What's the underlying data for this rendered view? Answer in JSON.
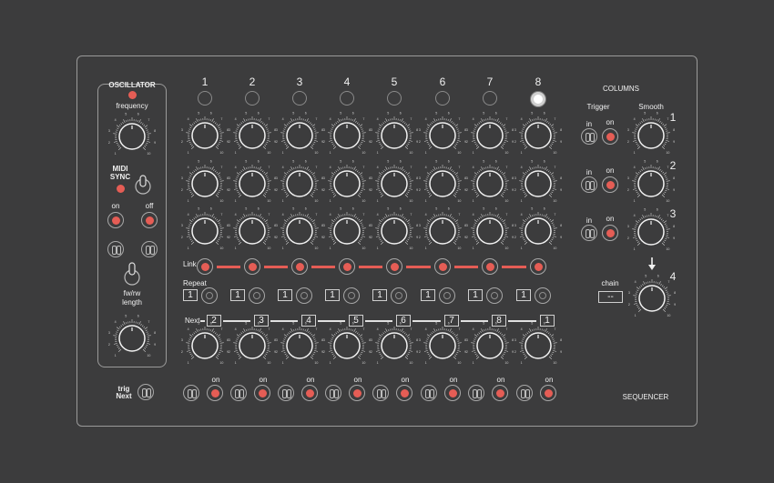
{
  "oscillator": {
    "title": "OSCILLATOR",
    "frequency_label": "frequency",
    "midi_sync_label": "MIDI\nSYNC",
    "on_label": "on",
    "off_label": "off",
    "direction_label": "fw/rw",
    "length_label": "length"
  },
  "columns": {
    "title": "COLUMNS",
    "trigger_label": "Trigger",
    "smooth_label": "Smooth",
    "on_label": "on",
    "in_label": "in",
    "numbers": [
      "1",
      "2",
      "3",
      "4"
    ],
    "chain_label": "chain",
    "chain_value": "--",
    "arrow": "down-arrow-icon"
  },
  "sequencer": {
    "title": "SEQUENCER",
    "step_numbers": [
      "1",
      "2",
      "3",
      "4",
      "5",
      "6",
      "7",
      "8"
    ],
    "active_step": "8",
    "link_label": "Link",
    "repeat_label": "Repeat",
    "repeat_values": [
      "1",
      "1",
      "1",
      "1",
      "1",
      "1",
      "1",
      "1"
    ],
    "next_label": "Next",
    "next_values": [
      "2",
      "3",
      "4",
      "5",
      "6",
      "7",
      "8",
      "1"
    ],
    "on_label": "on",
    "trig_label": "trig",
    "trig_next_label": "Next"
  },
  "knob_scale": {
    "small": [
      "1",
      "2",
      "3",
      "4",
      "5",
      "6",
      "7",
      "8",
      "9",
      "10"
    ]
  },
  "colors": {
    "background": "#3c3c3d",
    "accent": "#e55d55",
    "line": "#d8d8d8"
  }
}
